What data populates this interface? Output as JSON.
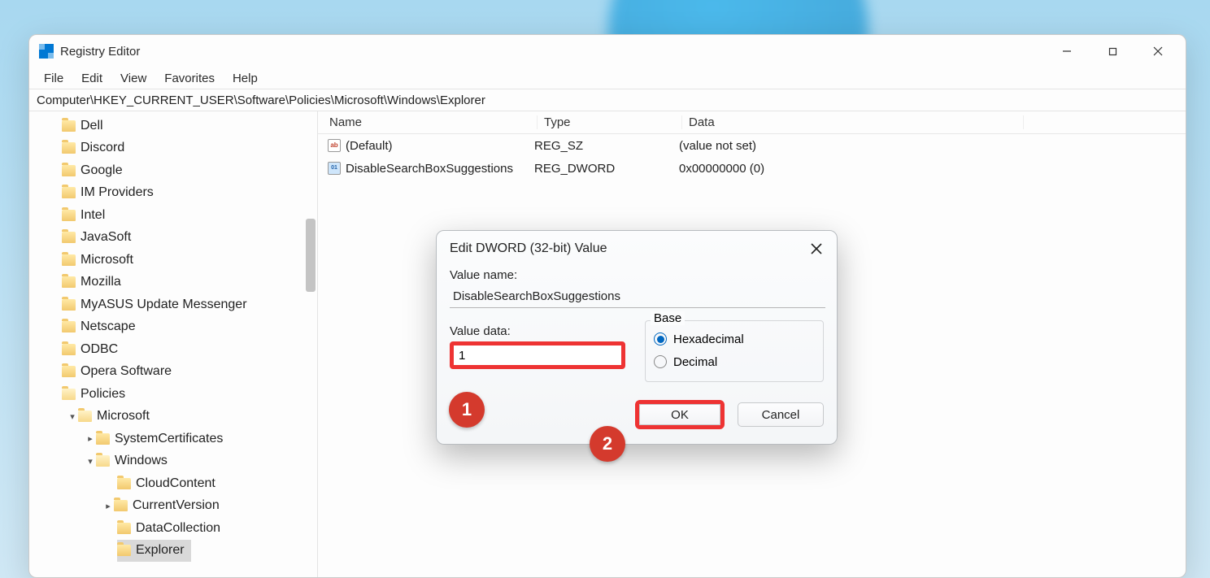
{
  "window": {
    "title": "Registry Editor",
    "menu": [
      "File",
      "Edit",
      "View",
      "Favorites",
      "Help"
    ],
    "address": "Computer\\HKEY_CURRENT_USER\\Software\\Policies\\Microsoft\\Windows\\Explorer"
  },
  "tree": {
    "items": [
      {
        "label": "Dell",
        "indent": 0,
        "chev": "",
        "open": false,
        "selected": false
      },
      {
        "label": "Discord",
        "indent": 0,
        "chev": "",
        "open": false,
        "selected": false
      },
      {
        "label": "Google",
        "indent": 0,
        "chev": "",
        "open": false,
        "selected": false
      },
      {
        "label": "IM Providers",
        "indent": 0,
        "chev": "",
        "open": false,
        "selected": false
      },
      {
        "label": "Intel",
        "indent": 0,
        "chev": "",
        "open": false,
        "selected": false
      },
      {
        "label": "JavaSoft",
        "indent": 0,
        "chev": "",
        "open": false,
        "selected": false
      },
      {
        "label": "Microsoft",
        "indent": 0,
        "chev": "",
        "open": false,
        "selected": false
      },
      {
        "label": "Mozilla",
        "indent": 0,
        "chev": "",
        "open": false,
        "selected": false
      },
      {
        "label": "MyASUS Update Messenger",
        "indent": 0,
        "chev": "",
        "open": false,
        "selected": false
      },
      {
        "label": "Netscape",
        "indent": 0,
        "chev": "",
        "open": false,
        "selected": false
      },
      {
        "label": "ODBC",
        "indent": 0,
        "chev": "",
        "open": false,
        "selected": false
      },
      {
        "label": "Opera Software",
        "indent": 0,
        "chev": "",
        "open": false,
        "selected": false
      },
      {
        "label": "Policies",
        "indent": 0,
        "chev": "",
        "open": true,
        "selected": false
      },
      {
        "label": "Microsoft",
        "indent": 1,
        "chev": "down",
        "open": true,
        "selected": false
      },
      {
        "label": "SystemCertificates",
        "indent": 2,
        "chev": "right",
        "open": false,
        "selected": false
      },
      {
        "label": "Windows",
        "indent": 2,
        "chev": "down",
        "open": true,
        "selected": false
      },
      {
        "label": "CloudContent",
        "indent": 3,
        "chev": "",
        "open": false,
        "selected": false
      },
      {
        "label": "CurrentVersion",
        "indent": 3,
        "chev": "right",
        "open": false,
        "selected": false
      },
      {
        "label": "DataCollection",
        "indent": 3,
        "chev": "",
        "open": false,
        "selected": false
      },
      {
        "label": "Explorer",
        "indent": 3,
        "chev": "",
        "open": false,
        "selected": true
      }
    ]
  },
  "list": {
    "headers": {
      "name": "Name",
      "type": "Type",
      "data": "Data"
    },
    "rows": [
      {
        "icon": "sz",
        "name": "(Default)",
        "type": "REG_SZ",
        "data": "(value not set)"
      },
      {
        "icon": "dw",
        "name": "DisableSearchBoxSuggestions",
        "type": "REG_DWORD",
        "data": "0x00000000 (0)"
      }
    ]
  },
  "dialog": {
    "title": "Edit DWORD (32-bit) Value",
    "labels": {
      "value_name": "Value name:",
      "value_data": "Value data:",
      "base": "Base"
    },
    "value_name": "DisableSearchBoxSuggestions",
    "value_data": "1",
    "base_options": {
      "hex": "Hexadecimal",
      "dec": "Decimal"
    },
    "base_selected": "hex",
    "buttons": {
      "ok": "OK",
      "cancel": "Cancel"
    }
  },
  "annotations": {
    "c1": "1",
    "c2": "2"
  }
}
